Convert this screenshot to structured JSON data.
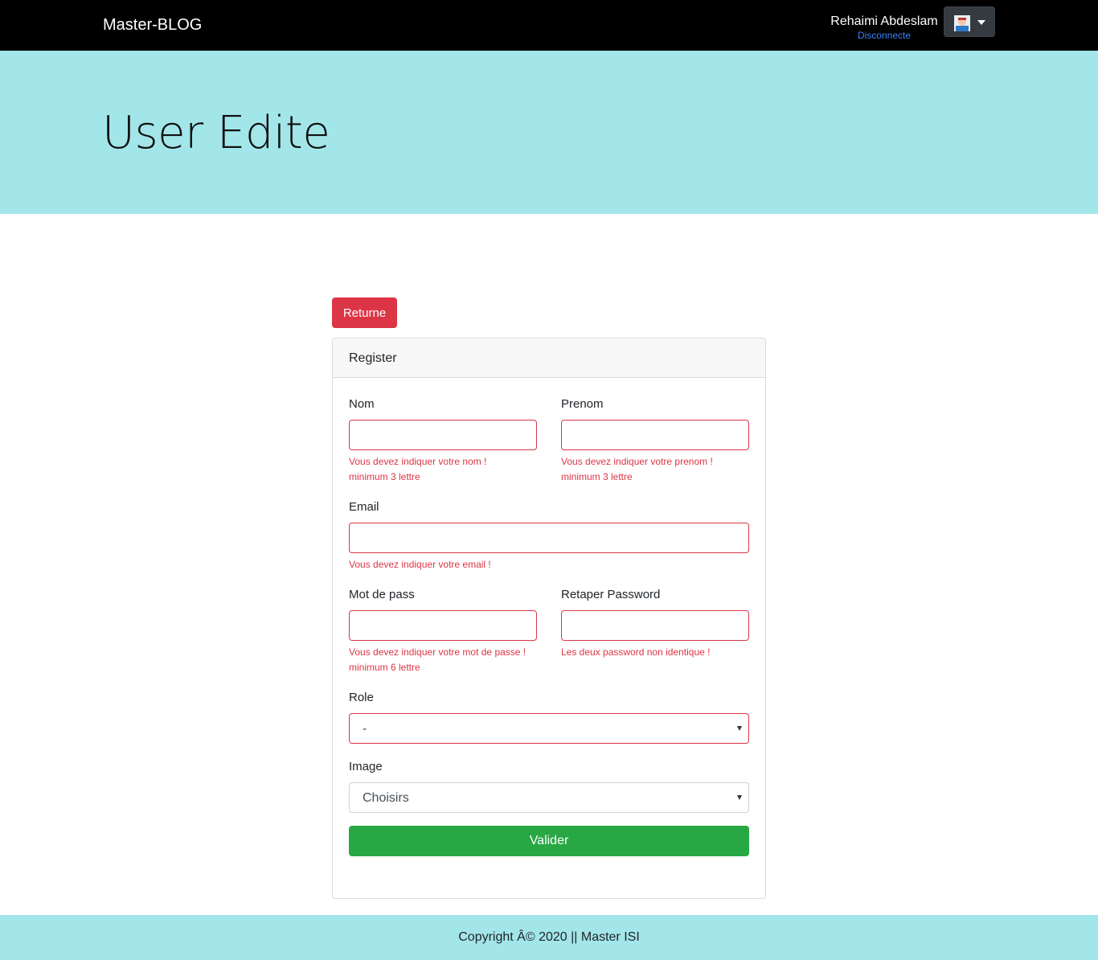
{
  "navbar": {
    "brand": "Master-BLOG",
    "user_name": "Rehaimi Abdeslam",
    "logout_label": "Disconnecte"
  },
  "header": {
    "title": "User Edite"
  },
  "return_label": "Returne",
  "card": {
    "title": "Register",
    "fields": {
      "nom": {
        "label": "Nom",
        "value": "",
        "error_line1": "Vous devez indiquer votre nom !",
        "error_line2": "minimum 3 lettre"
      },
      "prenom": {
        "label": "Prenom",
        "value": "",
        "error_line1": "Vous devez indiquer votre prenom !",
        "error_line2": "minimum 3 lettre"
      },
      "email": {
        "label": "Email",
        "value": "",
        "error_line1": "Vous devez indiquer votre email !"
      },
      "password": {
        "label": "Mot de pass",
        "value": "",
        "error_line1": "Vous devez indiquer votre mot de passe !",
        "error_line2": "minimum 6 lettre"
      },
      "retype": {
        "label": "Retaper Password",
        "value": "",
        "error_line1": "Les deux password non identique !"
      },
      "role": {
        "label": "Role",
        "selected": "-"
      },
      "image": {
        "label": "Image",
        "selected": "Choisirs"
      }
    },
    "submit_label": "Valider"
  },
  "footer": {
    "text": "Copyright Â© 2020 || Master ISI"
  },
  "colors": {
    "navbar_bg": "#000000",
    "accent_bg": "#a2e6ea",
    "danger": "#dc3545",
    "success": "#28a745",
    "link": "#3b82f6"
  }
}
